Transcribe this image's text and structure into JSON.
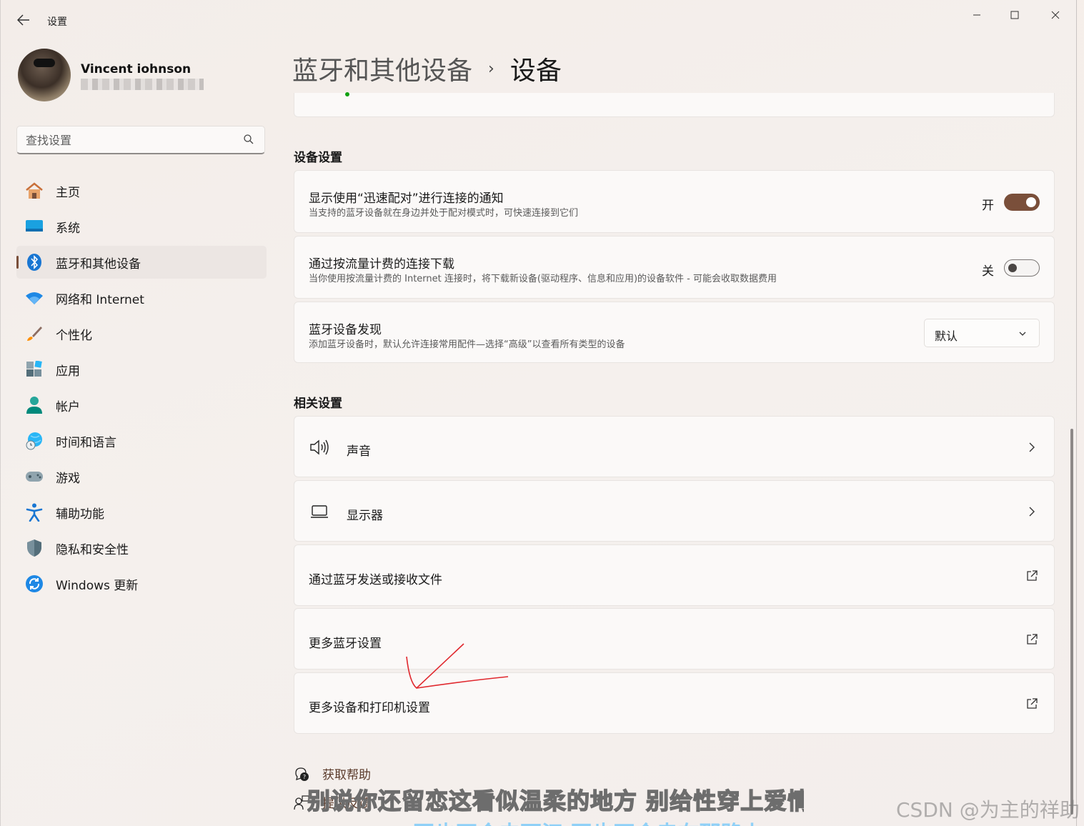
{
  "window": {
    "title": "设置",
    "controls": {
      "minimize": "—",
      "maximize": "☐",
      "close": "✕"
    }
  },
  "profile": {
    "name": "Vincent iohnson"
  },
  "search": {
    "placeholder": "查找设置"
  },
  "nav": {
    "items": [
      {
        "label": "主页",
        "icon": "home-icon"
      },
      {
        "label": "系统",
        "icon": "monitor-icon"
      },
      {
        "label": "蓝牙和其他设备",
        "icon": "bluetooth-icon",
        "active": true
      },
      {
        "label": "网络和 Internet",
        "icon": "wifi-icon"
      },
      {
        "label": "个性化",
        "icon": "brush-icon"
      },
      {
        "label": "应用",
        "icon": "apps-icon"
      },
      {
        "label": "帐户",
        "icon": "account-icon"
      },
      {
        "label": "时间和语言",
        "icon": "globe-clock-icon"
      },
      {
        "label": "游戏",
        "icon": "gamepad-icon"
      },
      {
        "label": "辅助功能",
        "icon": "accessibility-icon"
      },
      {
        "label": "隐私和安全性",
        "icon": "shield-icon"
      },
      {
        "label": "Windows 更新",
        "icon": "update-icon"
      }
    ]
  },
  "header": {
    "parent": "蓝牙和其他设备",
    "separator": "›",
    "current": "设备"
  },
  "device_settings": {
    "section_title": "设备设置",
    "swift_pair": {
      "title": "显示使用“迅速配对”进行连接的通知",
      "desc": "当支持的蓝牙设备就在身边并处于配对模式时，可快速连接到它们",
      "state_label": "开",
      "on": true
    },
    "metered": {
      "title": "通过按流量计费的连接下载",
      "desc": "当你使用按流量计费的 Internet 连接时，将下载新设备(驱动程序、信息和应用)的设备软件 - 可能会收取数据费用",
      "state_label": "关",
      "on": false
    },
    "discovery": {
      "title": "蓝牙设备发现",
      "desc": "添加蓝牙设备时，默认允许连接常用配件—选择“高级”以查看所有类型的设备",
      "selected": "默认"
    }
  },
  "related": {
    "section_title": "相关设置",
    "items": [
      {
        "label": "声音",
        "icon": "speaker-icon",
        "action": "chevron-right-icon"
      },
      {
        "label": "显示器",
        "icon": "display-icon",
        "action": "chevron-right-icon"
      },
      {
        "label": "通过蓝牙发送或接收文件",
        "action": "external-link-icon"
      },
      {
        "label": "更多蓝牙设置",
        "action": "external-link-icon"
      },
      {
        "label": "更多设备和打印机设置",
        "action": "external-link-icon"
      }
    ]
  },
  "help": {
    "get_help": "获取帮助",
    "feedback": "提供反馈"
  },
  "overlay": {
    "caption": "别说你还留恋这看似温柔的地方 别给性穿上爱情",
    "caption2": "再也不会去西江 再也不会走在那路上",
    "watermark": "CSDN @为主的祥助"
  },
  "colors": {
    "accent": "#7a4f3a",
    "annotation": "#e0282e"
  }
}
